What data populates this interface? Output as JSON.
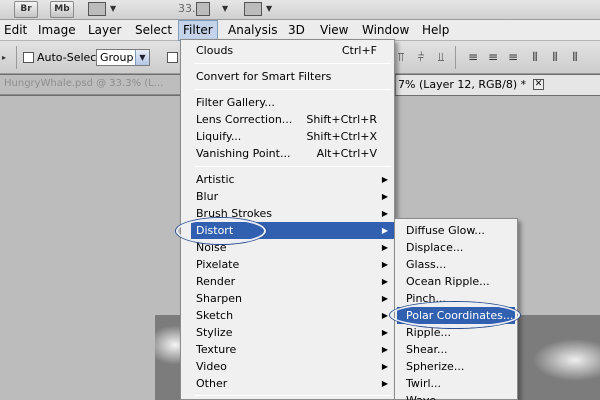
{
  "appbar": {
    "bridge_label": "Br",
    "minibridge_label": "Mb",
    "zoom_value": "33.3"
  },
  "menubar": {
    "items": [
      "Edit",
      "Image",
      "Layer",
      "Select",
      "Filter",
      "Analysis",
      "3D",
      "View",
      "Window",
      "Help"
    ],
    "open_item": "Filter"
  },
  "options_bar": {
    "auto_select_label": "Auto-Select:",
    "auto_select_value": "Group",
    "auto_select_checked": false
  },
  "tabs": {
    "inactive_tab_text": "HungryWhale.psd @ 33.3% (L...",
    "active_tab_text": "7% (Layer 12, RGB/8) *",
    "close_glyph": "✕"
  },
  "filter_menu": {
    "items": [
      {
        "label": "Clouds",
        "shortcut": "Ctrl+F"
      },
      {
        "label": "Convert for Smart Filters"
      },
      {
        "label": "Filter Gallery..."
      },
      {
        "label": "Lens Correction...",
        "shortcut": "Shift+Ctrl+R"
      },
      {
        "label": "Liquify...",
        "shortcut": "Shift+Ctrl+X"
      },
      {
        "label": "Vanishing Point...",
        "shortcut": "Alt+Ctrl+V"
      },
      {
        "label": "Artistic",
        "submenu": true
      },
      {
        "label": "Blur",
        "submenu": true
      },
      {
        "label": "Brush Strokes",
        "submenu": true
      },
      {
        "label": "Distort",
        "submenu": true,
        "highlighted": true
      },
      {
        "label": "Noise",
        "submenu": true
      },
      {
        "label": "Pixelate",
        "submenu": true
      },
      {
        "label": "Render",
        "submenu": true
      },
      {
        "label": "Sharpen",
        "submenu": true
      },
      {
        "label": "Sketch",
        "submenu": true
      },
      {
        "label": "Stylize",
        "submenu": true
      },
      {
        "label": "Texture",
        "submenu": true
      },
      {
        "label": "Video",
        "submenu": true
      },
      {
        "label": "Other",
        "submenu": true
      }
    ]
  },
  "distort_submenu": {
    "items": [
      {
        "label": "Diffuse Glow..."
      },
      {
        "label": "Displace..."
      },
      {
        "label": "Glass..."
      },
      {
        "label": "Ocean Ripple..."
      },
      {
        "label": "Pinch..."
      },
      {
        "label": "Polar Coordinates...",
        "highlighted": true
      },
      {
        "label": "Ripple..."
      },
      {
        "label": "Shear..."
      },
      {
        "label": "Spherize..."
      },
      {
        "label": "Twirl..."
      },
      {
        "label": "Wave..."
      }
    ]
  },
  "colors": {
    "menu_highlight": "#3160b1",
    "menu_background": "#f0f0f0",
    "annotation_ring": "#2c4c8a"
  },
  "icons": {
    "submenu_arrow": "submenu-arrow-icon",
    "dropdown_arrow": "dropdown-arrow-icon"
  }
}
